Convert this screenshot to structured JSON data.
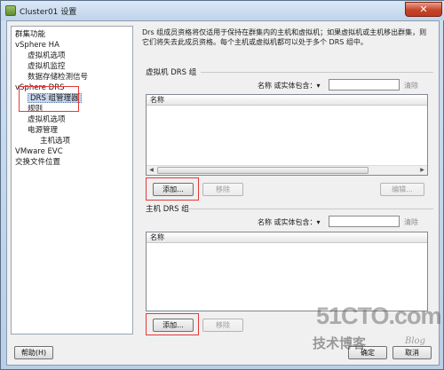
{
  "window": {
    "title": "Cluster01 设置",
    "close_glyph": "✕"
  },
  "tree": {
    "items": [
      {
        "label": "群集功能"
      },
      {
        "label": "vSphere HA"
      },
      {
        "label": "虚拟机选项"
      },
      {
        "label": "虚拟机监控"
      },
      {
        "label": "数据存储检测信号"
      },
      {
        "label": "vSphere DRS"
      },
      {
        "label": "DRS 组管理器"
      },
      {
        "label": "规则"
      },
      {
        "label": "虚拟机选项"
      },
      {
        "label": "电源管理"
      },
      {
        "label": "主机选项"
      },
      {
        "label": "VMware EVC"
      },
      {
        "label": "交换文件位置"
      }
    ],
    "selected": "DRS 组管理器"
  },
  "content": {
    "description": "Drs 组成员资格将仅适用于保持在群集内的主机和虚拟机；如果虚拟机或主机移出群集，则它们将失去此成员资格。每个主机或虚拟机都可以处于多个 DRS 组中。",
    "vm_group": {
      "title": "虚拟机 DRS 组",
      "filter_label": "名称 或实体包含：▾",
      "filter_value": "",
      "clear_label": "清除",
      "column_header": "名称",
      "add_label": "添加...",
      "remove_label": "移除",
      "edit_label": "编辑..."
    },
    "host_group": {
      "title": "主机 DRS 组",
      "filter_label": "名称 或实体包含：▾",
      "filter_value": "",
      "clear_label": "清除",
      "column_header": "名称",
      "add_label": "添加...",
      "remove_label": "移除"
    }
  },
  "footer": {
    "help_label": "帮助(H)",
    "ok_label": "确定",
    "cancel_label": "取消"
  },
  "watermark": {
    "site": "51CTO.com",
    "tagline": "技术博客",
    "blog": "Blog"
  },
  "colors": {
    "highlight_box": "#e53935",
    "selection": "#c8d8ee"
  }
}
